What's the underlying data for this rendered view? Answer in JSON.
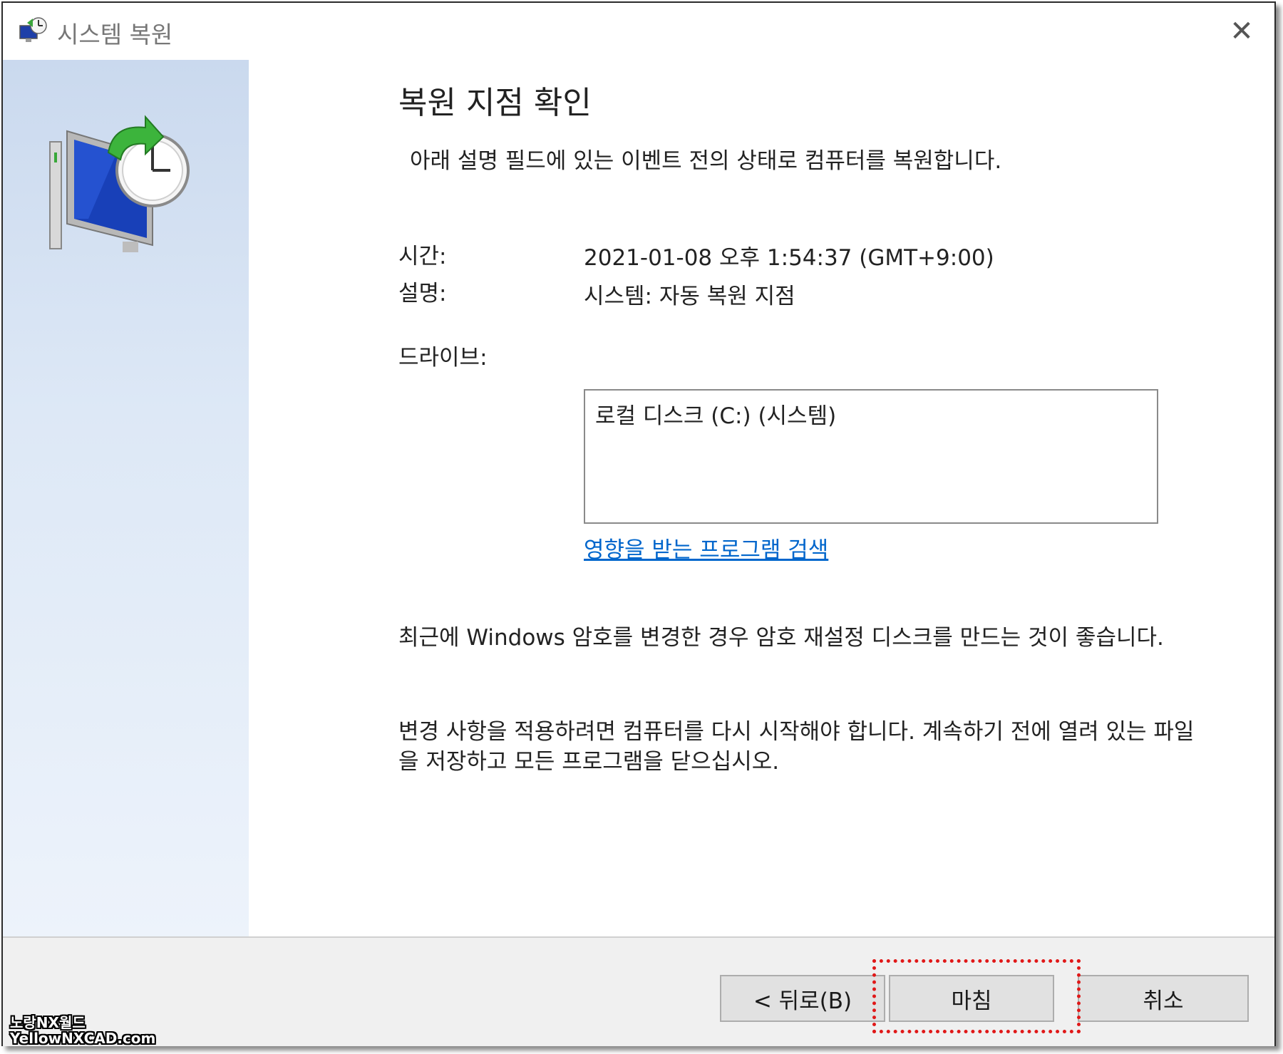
{
  "window": {
    "title": "시스템 복원",
    "close_glyph": "✕"
  },
  "icons": {
    "title_icon": "system-restore-icon",
    "hero_icon": "system-restore-computer-clock-icon"
  },
  "main": {
    "heading": "복원 지점 확인",
    "subtitle": "아래 설명 필드에 있는 이벤트 전의 상태로 컴퓨터를 복원합니다.",
    "time_label": "시간:",
    "time_value": "2021-01-08 오후 1:54:37 (GMT+9:00)",
    "desc_label": "설명:",
    "desc_value": "시스템: 자동 복원 지점",
    "drive_label": "드라이브:",
    "drives": [
      "로컬 디스크 (C:) (시스템)"
    ],
    "affected_link": "영향을 받는 프로그램 검색",
    "password_note": "최근에 Windows 암호를 변경한 경우 암호 재설정 디스크를 만드는 것이 좋습니다.",
    "restart_note": "변경 사항을 적용하려면 컴퓨터를 다시 시작해야 합니다. 계속하기 전에 열려 있는 파일을 저장하고 모든 프로그램을 닫으십시오."
  },
  "footer": {
    "back_label": "< 뒤로(B)",
    "finish_label": "마침",
    "cancel_label": "취소",
    "highlight_color": "#e01818"
  },
  "watermark": {
    "line1": "노랑NX월드",
    "line2": "YellowNXCAD.com"
  },
  "colors": {
    "link": "#0066cc",
    "sidebar_top": "#cad9ee",
    "footer_bg": "#f0f0f0"
  }
}
